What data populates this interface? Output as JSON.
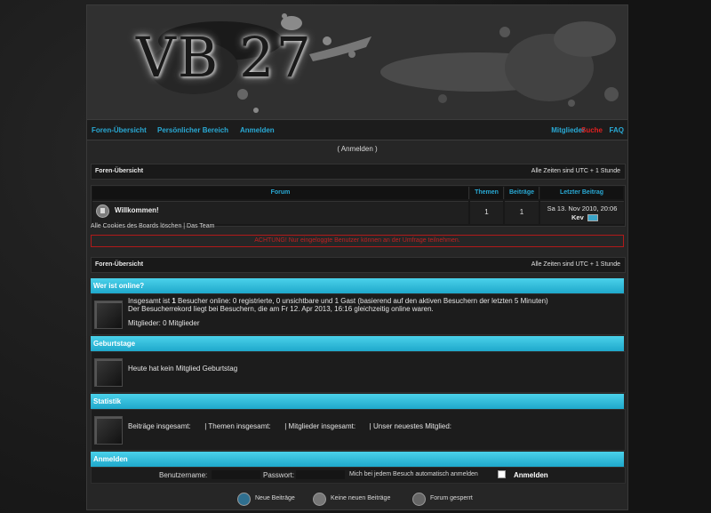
{
  "logo": {
    "text": "VB 27"
  },
  "nav": {
    "left": [
      "Foren-Übersicht",
      "Persönlicher Bereich",
      "Anmelden"
    ],
    "right": [
      "Mitglieder",
      "Suche",
      "FAQ"
    ]
  },
  "login_link": "( Anmelden )",
  "breadcrumb": {
    "title": "Foren-Übersicht",
    "timezone": "Alle Zeiten sind UTC + 1 Stunde"
  },
  "forum_table": {
    "headers": [
      "Forum",
      "Themen",
      "Beiträge",
      "Letzter Beitrag"
    ],
    "rows": [
      {
        "name": "Willkommen!",
        "topics": "1",
        "posts": "1",
        "last_date": "Sa 13. Nov 2010, 20:06",
        "last_user": "Kev"
      }
    ]
  },
  "footer_links": "Alle Cookies des Boards löschen | Das Team",
  "warning": "ACHTUNG! Nur eingeloggte Benutzer können an der Umfrage teilnehmen.",
  "breadcrumb2": {
    "title": "Foren-Übersicht",
    "timezone": "Alle Zeiten sind UTC + 1 Stunde"
  },
  "online": {
    "title": "Wer ist online?",
    "line1_prefix": "Insgesamt ist ",
    "line1_count": "1",
    "line1_suffix": " Besucher online: 0 registrierte, 0 unsichtbare und 1 Gast (basierend auf den aktiven Besuchern der letzten 5 Minuten)",
    "line2": "Der Besucherrekord liegt bei     Besuchern, die am Fr 12. Apr 2013, 16:16 gleichzeitig online waren.",
    "members": "Mitglieder: 0 Mitglieder"
  },
  "birthdays": {
    "title": "Geburtstage",
    "text": "Heute hat kein Mitglied Geburtstag"
  },
  "stats": {
    "title": "Statistik",
    "text": "Beiträge insgesamt:       | Themen insgesamt:       | Mitglieder insgesamt:       | Unser neuestes Mitglied:"
  },
  "login": {
    "title": "Anmelden",
    "username_label": "Benutzername:",
    "password_label": "Passwort:",
    "remember_label": "Mich bei jedem Besuch automatisch anmelden",
    "submit": "Anmelden"
  },
  "legend": [
    "Neue Beiträge",
    "Keine neuen Beiträge",
    "Forum gesperrt"
  ],
  "colors": {
    "accent": "#29a9d4",
    "search": "#e02020",
    "section": "#2cb8d8",
    "warning": "#c02121"
  }
}
